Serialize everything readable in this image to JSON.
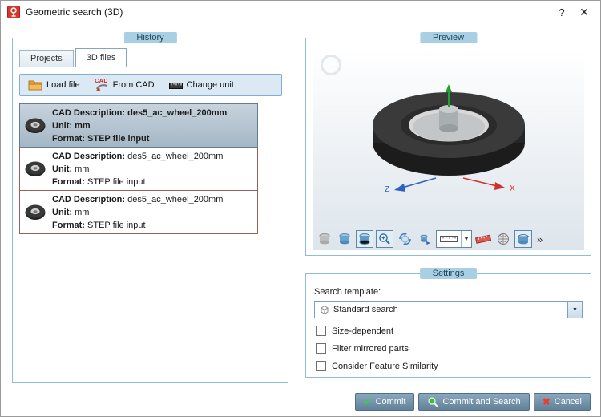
{
  "window": {
    "title": "Geometric search (3D)"
  },
  "icons": {
    "help": "?",
    "close": "✕",
    "dropdown_arrow": "▼",
    "check": "✔",
    "cross": "✖",
    "overflow": "»"
  },
  "history": {
    "label": "History",
    "tabs": {
      "projects": "Projects",
      "files3d": "3D files"
    },
    "toolbar": {
      "load_file": "Load file",
      "cad_badge": "CAD",
      "from_cad": "From CAD",
      "change_unit": "Change unit"
    },
    "items": [
      {
        "cad_label": "CAD Description:",
        "cad_value": "des5_ac_wheel_200mm",
        "unit_label": "Unit:",
        "unit_value": "mm",
        "format_label": "Format:",
        "format_value": "STEP file input",
        "selected": true
      },
      {
        "cad_label": "CAD Description:",
        "cad_value": "des5_ac_wheel_200mm",
        "unit_label": "Unit:",
        "unit_value": "mm",
        "format_label": "Format:",
        "format_value": "STEP file input",
        "selected": false
      },
      {
        "cad_label": "CAD Description:",
        "cad_value": "des5_ac_wheel_200mm",
        "unit_label": "Unit:",
        "unit_value": "mm",
        "format_label": "Format:",
        "format_value": "STEP file input",
        "selected": false
      }
    ]
  },
  "preview": {
    "label": "Preview",
    "axes": {
      "x": "X",
      "z": "Z"
    }
  },
  "settings": {
    "label": "Settings",
    "search_template_label": "Search template:",
    "template_value": "Standard search",
    "checkboxes": [
      {
        "label": "Size-dependent",
        "checked": false
      },
      {
        "label": "Filter mirrored parts",
        "checked": false
      },
      {
        "label": "Consider Feature Similarity",
        "checked": false
      }
    ]
  },
  "footer": {
    "commit": "Commit",
    "commit_and_search": "Commit and Search",
    "cancel": "Cancel"
  },
  "colors": {
    "group_badge": "#a9cfe5",
    "group_border": "#8fbcd9",
    "toolbar_bg": "#dbe9f5",
    "selected_item": "#b0c2cf",
    "item_border": "#9a6060",
    "button_blue": "#6e8ea6",
    "commit_green": "#35d23c",
    "cancel_red": "#ef3b2a"
  }
}
